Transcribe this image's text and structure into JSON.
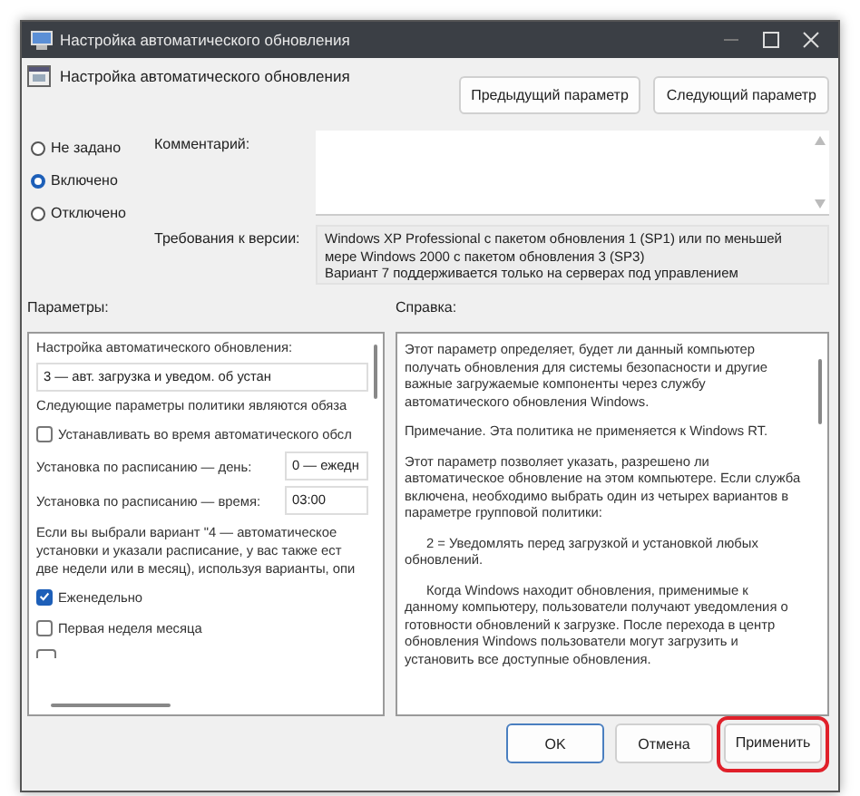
{
  "window": {
    "title": "Настройка автоматического обновления"
  },
  "header": {
    "title": "Настройка автоматического обновления",
    "buttons": [
      "Предыдущий параметр",
      "Следующий параметр"
    ]
  },
  "radios": [
    {
      "label": "Не задано",
      "selected": false
    },
    {
      "label": "Включено",
      "selected": true
    },
    {
      "label": "Отключено",
      "selected": false
    }
  ],
  "comment": {
    "label": "Комментарий:"
  },
  "requirements": {
    "label": "Требования к версии:",
    "lines": [
      "Windows XP Professional с пакетом обновления 1 (SP1) или по меньшей",
      "мере Windows 2000 с пакетом обновления 3 (SP3)",
      "Вариант 7 поддерживается только на серверах под управлением"
    ]
  },
  "options": {
    "label": "Параметры:",
    "items": [
      {
        "kind": "label",
        "text": "Настройка автоматического обновления:"
      },
      {
        "kind": "dropdown",
        "value": "3 — авт. загрузка и уведом. об устан"
      },
      {
        "kind": "label",
        "text": "Следующие параметры политики являются обяза"
      },
      {
        "kind": "checkbox",
        "label": "Устанавливать во время автоматического обсл",
        "checked": false
      },
      {
        "kind": "field",
        "label": "Установка по расписанию — день:",
        "value": "0 — ежедн"
      },
      {
        "kind": "field",
        "label": "Установка по расписанию — время:",
        "value": "03:00"
      },
      {
        "kind": "paragraph",
        "lines": [
          "Если вы выбрали вариант \"4 — автоматическое",
          "установки и указали расписание, у вас также ест",
          "две недели или в месяц), используя варианты, опи"
        ]
      },
      {
        "kind": "checkbox",
        "label": "Еженедельно",
        "checked": true
      },
      {
        "kind": "checkbox",
        "label": "Первая неделя месяца",
        "checked": false
      }
    ]
  },
  "help": {
    "label": "Справка:",
    "paragraphs": [
      {
        "text": "Этот параметр определяет, будет ли данный компьютер получать обновления для системы безопасности и другие важные загружаемые компоненты через службу автоматического обновления Windows.",
        "indent": false
      },
      {
        "text": "Примечание. Эта политика не применяется к Windows RT.",
        "indent": false
      },
      {
        "text": "Этот параметр позволяет указать, разрешено ли автоматическое обновление на этом компьютере. Если служба включена, необходимо выбрать один из четырех вариантов в параметре групповой политики:",
        "indent": false
      },
      {
        "text": "2 = Уведомлять перед загрузкой и установкой любых обновлений.",
        "indent": true
      },
      {
        "text": "Когда Windows находит обновления, применимые к данному компьютеру, пользователи получают уведомления о готовности обновлений к загрузке. После перехода в центр обновления Windows пользователи могут загрузить и установить все доступные обновления.",
        "indent": true
      }
    ]
  },
  "footer": {
    "buttons": [
      {
        "label": "OK",
        "default": true,
        "highlighted": false
      },
      {
        "label": "Отмена",
        "default": false,
        "highlighted": false
      },
      {
        "label": "Применить",
        "default": false,
        "highlighted": true
      }
    ]
  }
}
